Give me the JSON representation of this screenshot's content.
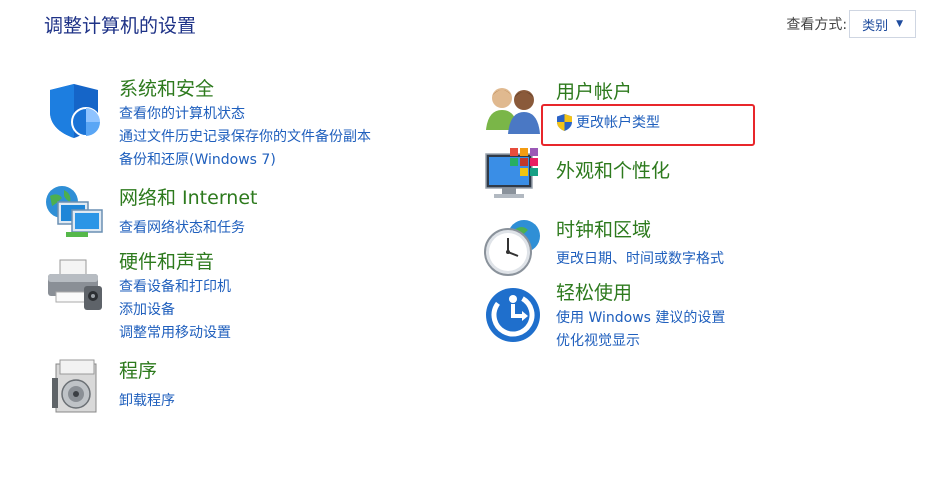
{
  "header": {
    "title": "调整计算机的设置",
    "view_by_label": "查看方式:",
    "view_by_value": "类别"
  },
  "categories": [
    {
      "title": "系统和安全",
      "links": [
        "查看你的计算机状态",
        "通过文件历史记录保存你的文件备份副本",
        "备份和还原(Windows 7)"
      ]
    },
    {
      "title": "网络和 Internet",
      "links": [
        "查看网络状态和任务"
      ]
    },
    {
      "title": "硬件和声音",
      "links": [
        "查看设备和打印机",
        "添加设备",
        "调整常用移动设置"
      ]
    },
    {
      "title": "程序",
      "links": [
        "卸载程序"
      ]
    },
    {
      "title": "用户帐户",
      "links": [
        "更改帐户类型"
      ]
    },
    {
      "title": "外观和个性化",
      "links": []
    },
    {
      "title": "时钟和区域",
      "links": [
        "更改日期、时间或数字格式"
      ]
    },
    {
      "title": "轻松使用",
      "links": [
        "使用 Windows 建议的设置",
        "优化视觉显示"
      ]
    }
  ],
  "icons": {
    "system_security": "shield-icon",
    "network": "network-globe-icon",
    "hardware": "printer-icon",
    "programs": "programs-disc-icon",
    "user_accounts": "users-icon",
    "uac_shield": "uac-shield-icon",
    "appearance": "monitor-colors-icon",
    "clock_region": "clock-globe-icon",
    "ease_of_access": "ease-of-access-icon"
  },
  "colors": {
    "title": "#1e3287",
    "category_title": "#2d7a1d",
    "link": "#1f5fbd",
    "highlight": "#e8262b"
  }
}
